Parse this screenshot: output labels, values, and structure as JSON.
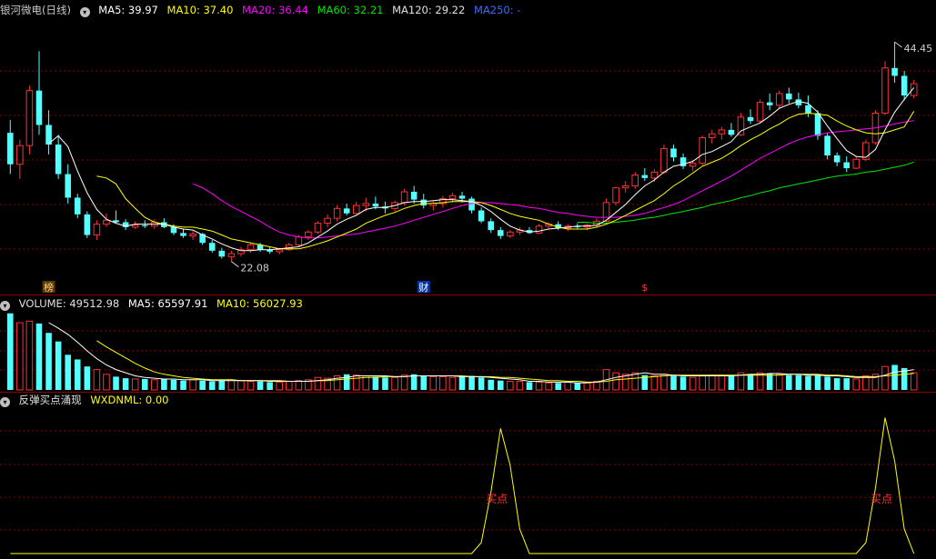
{
  "colors": {
    "background": "#000000",
    "up": "#ff3232",
    "down": "#54ffff",
    "ma5": "#ffffff",
    "ma10": "#ffff00",
    "ma20": "#ff00ff",
    "ma60": "#00e600",
    "ma120": "#e0e0e0",
    "ma250": "#3030ff",
    "grid": "#8b0000",
    "signal": "#ffff00",
    "signal_text": "#ff3232"
  },
  "price_panel": {
    "title": "银河微电(日线)",
    "ma_labels": [
      {
        "key": "ma5",
        "text": "MA5: 39.97"
      },
      {
        "key": "ma10",
        "text": "MA10: 37.40"
      },
      {
        "key": "ma20",
        "text": "MA20: 36.44"
      },
      {
        "key": "ma60",
        "text": "MA60: 32.21"
      },
      {
        "key": "ma120",
        "text": "MA120: 29.22"
      },
      {
        "key": "ma250",
        "text": "MA250: -"
      }
    ],
    "high_label": "44.45",
    "low_label": "22.08",
    "markers": [
      {
        "text": "榜",
        "index": 4,
        "color": "#ffd27f",
        "bg": "#5a3a00"
      },
      {
        "text": "财",
        "index": 43,
        "color": "#ffffff",
        "bg": "#0033aa"
      },
      {
        "text": "$",
        "index": 66,
        "color": "#ff3232",
        "bg": ""
      }
    ]
  },
  "volume_panel": {
    "labels": [
      {
        "key": "ma120",
        "text": "VOLUME: 49512.98"
      },
      {
        "key": "ma5",
        "text": "MA5: 65597.91"
      },
      {
        "key": "ma10",
        "text": "MA10: 56027.93"
      }
    ]
  },
  "indicator_panel": {
    "labels": [
      {
        "key": "ma120",
        "text": "反弹买点涌现"
      },
      {
        "key": "ma10",
        "text": "WXDNML: 0.00"
      }
    ],
    "signal_label": "买点"
  },
  "chart_data": {
    "type": "candlestick",
    "title": "银河微电(日线)",
    "ylim": [
      20.5,
      46.5
    ],
    "candles": [
      [
        35.2,
        36.5,
        31.0,
        32.0
      ],
      [
        32.0,
        34.5,
        30.5,
        33.9
      ],
      [
        33.9,
        40.0,
        33.0,
        39.5
      ],
      [
        39.5,
        43.5,
        35.0,
        36.0
      ],
      [
        36.0,
        37.5,
        33.0,
        34.0
      ],
      [
        34.0,
        35.0,
        30.5,
        31.0
      ],
      [
        31.0,
        32.0,
        28.0,
        28.6
      ],
      [
        28.6,
        29.0,
        26.5,
        26.9
      ],
      [
        26.9,
        27.2,
        24.5,
        24.8
      ],
      [
        24.8,
        26.3,
        24.3,
        25.9
      ],
      [
        25.9,
        27.0,
        25.6,
        26.3
      ],
      [
        26.3,
        27.3,
        26.0,
        26.1
      ],
      [
        26.1,
        26.4,
        25.3,
        25.6
      ],
      [
        25.6,
        26.2,
        25.4,
        25.8
      ],
      [
        25.8,
        26.3,
        25.5,
        25.7
      ],
      [
        25.7,
        26.4,
        25.4,
        26.1
      ],
      [
        26.1,
        26.5,
        25.5,
        25.6
      ],
      [
        25.6,
        25.9,
        24.8,
        25.0
      ],
      [
        25.0,
        25.4,
        24.5,
        24.7
      ],
      [
        24.7,
        25.2,
        24.3,
        24.9
      ],
      [
        24.9,
        25.0,
        23.8,
        24.0
      ],
      [
        24.0,
        24.3,
        23.0,
        23.2
      ],
      [
        23.2,
        23.5,
        22.4,
        22.6
      ],
      [
        22.6,
        23.2,
        22.1,
        22.9
      ],
      [
        22.9,
        23.6,
        22.6,
        23.3
      ],
      [
        23.3,
        24.0,
        23.0,
        23.8
      ],
      [
        23.8,
        24.0,
        23.1,
        23.3
      ],
      [
        23.3,
        23.6,
        22.9,
        23.1
      ],
      [
        23.1,
        23.5,
        22.8,
        23.3
      ],
      [
        23.3,
        24.0,
        23.2,
        23.8
      ],
      [
        23.8,
        24.8,
        23.6,
        24.6
      ],
      [
        24.6,
        25.3,
        24.3,
        25.1
      ],
      [
        25.1,
        26.2,
        24.9,
        26.0
      ],
      [
        26.0,
        26.9,
        25.6,
        26.5
      ],
      [
        26.5,
        27.8,
        26.2,
        27.5
      ],
      [
        27.5,
        28.0,
        26.8,
        27.0
      ],
      [
        27.0,
        28.2,
        26.9,
        27.8
      ],
      [
        27.8,
        28.6,
        27.2,
        28.0
      ],
      [
        28.0,
        28.7,
        27.4,
        27.7
      ],
      [
        27.7,
        28.2,
        27.0,
        27.5
      ],
      [
        27.5,
        28.3,
        27.2,
        28.1
      ],
      [
        28.1,
        29.5,
        27.8,
        29.2
      ],
      [
        29.2,
        29.8,
        28.0,
        28.4
      ],
      [
        28.4,
        29.0,
        27.5,
        27.8
      ],
      [
        27.8,
        28.3,
        27.3,
        28.0
      ],
      [
        28.0,
        28.8,
        27.6,
        28.5
      ],
      [
        28.5,
        29.1,
        28.1,
        28.8
      ],
      [
        28.8,
        29.2,
        28.1,
        28.5
      ],
      [
        28.5,
        28.7,
        27.0,
        27.3
      ],
      [
        27.3,
        27.6,
        26.0,
        26.2
      ],
      [
        26.2,
        26.5,
        25.0,
        25.3
      ],
      [
        25.3,
        25.6,
        24.4,
        24.7
      ],
      [
        24.7,
        25.3,
        24.5,
        25.1
      ],
      [
        25.1,
        25.6,
        24.8,
        25.3
      ],
      [
        25.3,
        25.6,
        24.9,
        25.0
      ],
      [
        25.0,
        25.9,
        24.9,
        25.7
      ],
      [
        25.7,
        26.1,
        25.4,
        25.9
      ],
      [
        25.9,
        26.2,
        25.3,
        25.5
      ],
      [
        25.5,
        25.9,
        25.2,
        25.7
      ],
      [
        25.7,
        26.0,
        25.4,
        25.6
      ],
      [
        25.6,
        26.0,
        25.3,
        25.8
      ],
      [
        25.8,
        26.5,
        25.6,
        26.2
      ],
      [
        26.2,
        28.5,
        26.1,
        28.1
      ],
      [
        28.1,
        29.7,
        27.8,
        29.6
      ],
      [
        29.6,
        30.3,
        29.1,
        29.8
      ],
      [
        29.8,
        31.2,
        29.5,
        30.9
      ],
      [
        30.9,
        31.6,
        30.3,
        30.6
      ],
      [
        30.6,
        31.5,
        30.2,
        31.2
      ],
      [
        31.2,
        34.0,
        31.0,
        33.6
      ],
      [
        33.6,
        34.0,
        32.3,
        32.7
      ],
      [
        32.7,
        33.1,
        31.5,
        31.8
      ],
      [
        31.8,
        32.4,
        31.3,
        32.1
      ],
      [
        32.1,
        34.9,
        31.9,
        34.7
      ],
      [
        34.7,
        35.5,
        34.1,
        35.1
      ],
      [
        35.1,
        35.8,
        34.5,
        35.5
      ],
      [
        35.5,
        36.2,
        34.8,
        35.0
      ],
      [
        35.0,
        37.2,
        34.9,
        36.8
      ],
      [
        36.8,
        37.6,
        36.1,
        36.4
      ],
      [
        36.4,
        38.6,
        36.2,
        38.3
      ],
      [
        38.3,
        39.2,
        37.5,
        38.0
      ],
      [
        38.0,
        39.5,
        37.7,
        39.2
      ],
      [
        39.2,
        39.8,
        38.2,
        38.6
      ],
      [
        38.6,
        39.3,
        37.7,
        38.0
      ],
      [
        38.0,
        39.0,
        36.8,
        37.2
      ],
      [
        37.2,
        37.5,
        34.5,
        34.9
      ],
      [
        34.9,
        35.2,
        32.5,
        32.9
      ],
      [
        32.9,
        33.2,
        31.8,
        32.2
      ],
      [
        32.2,
        32.8,
        31.2,
        31.6
      ],
      [
        31.6,
        32.8,
        31.5,
        32.5
      ],
      [
        32.5,
        34.5,
        32.3,
        34.2
      ],
      [
        34.2,
        37.5,
        34.0,
        37.2
      ],
      [
        37.2,
        42.5,
        37.0,
        41.8
      ],
      [
        41.8,
        44.45,
        40.3,
        41.0
      ],
      [
        41.0,
        41.5,
        38.5,
        39.0
      ],
      [
        39.0,
        40.6,
        38.7,
        40.2
      ]
    ],
    "ma5": [
      null,
      null,
      null,
      null,
      34.1,
      34.9,
      33.8,
      31.3,
      29.1,
      27.4,
      26.4,
      26.0,
      25.7,
      25.9,
      25.9,
      25.9,
      25.9,
      25.6,
      25.4,
      25.3,
      24.8,
      24.4,
      23.9,
      23.5,
      23.2,
      23.2,
      23.3,
      23.3,
      23.4,
      23.5,
      23.6,
      24.0,
      24.6,
      25.2,
      25.9,
      26.4,
      26.8,
      27.4,
      27.6,
      27.6,
      27.8,
      28.1,
      28.2,
      28.2,
      28.3,
      28.4,
      28.4,
      28.3,
      28.2,
      27.8,
      27.2,
      26.4,
      25.7,
      25.3,
      25.1,
      25.2,
      25.4,
      25.5,
      25.6,
      25.7,
      25.7,
      25.8,
      26.3,
      27.1,
      27.9,
      28.9,
      29.8,
      30.4,
      31.2,
      31.8,
      32.0,
      32.3,
      33.0,
      33.3,
      33.8,
      34.3,
      35.4,
      35.8,
      36.2,
      36.9,
      37.7,
      38.1,
      38.4,
      38.2,
      37.3,
      35.9,
      34.6,
      33.4,
      32.8,
      32.7,
      33.5,
      35.5,
      37.3,
      38.6,
      39.8
    ],
    "ma10": [
      null,
      null,
      null,
      null,
      null,
      null,
      null,
      null,
      null,
      30.8,
      30.6,
      30.0,
      28.5,
      27.5,
      26.6,
      26.1,
      25.9,
      25.7,
      25.6,
      25.6,
      25.4,
      25.2,
      24.8,
      24.4,
      24.2,
      24.0,
      23.8,
      23.6,
      23.4,
      23.4,
      23.4,
      23.6,
      23.9,
      24.2,
      24.6,
      25.0,
      25.4,
      26.0,
      26.4,
      26.8,
      27.1,
      27.5,
      27.8,
      28.0,
      28.0,
      28.1,
      28.2,
      28.2,
      28.2,
      28.1,
      27.8,
      27.4,
      27.0,
      26.7,
      26.5,
      26.3,
      25.9,
      25.6,
      25.4,
      25.4,
      25.4,
      25.6,
      25.9,
      26.3,
      26.8,
      27.3,
      27.8,
      28.3,
      29.0,
      29.8,
      30.4,
      31.1,
      31.8,
      32.2,
      32.6,
      33.2,
      33.9,
      34.5,
      35.0,
      35.6,
      36.1,
      36.7,
      37.1,
      37.2,
      37.1,
      37.0,
      36.4,
      35.9,
      35.5,
      35.2,
      35.1,
      35.2,
      35.5,
      35.8,
      37.4
    ],
    "ma20": [
      null,
      null,
      null,
      null,
      null,
      null,
      null,
      null,
      null,
      null,
      null,
      null,
      null,
      null,
      null,
      null,
      null,
      null,
      null,
      30.0,
      29.6,
      29.0,
      28.3,
      27.7,
      27.2,
      26.7,
      26.2,
      25.6,
      25.1,
      24.8,
      24.6,
      24.5,
      24.5,
      24.6,
      24.7,
      24.8,
      24.9,
      25.1,
      25.3,
      25.5,
      25.7,
      26.0,
      26.3,
      26.6,
      26.9,
      27.2,
      27.5,
      27.8,
      28.0,
      28.1,
      28.1,
      28.0,
      27.9,
      27.8,
      27.6,
      27.5,
      27.3,
      27.1,
      27.0,
      26.8,
      26.7,
      26.6,
      26.6,
      26.6,
      26.7,
      26.8,
      27.0,
      27.3,
      27.6,
      27.9,
      28.3,
      28.8,
      29.3,
      29.8,
      30.3,
      30.8,
      31.4,
      32.0,
      32.6,
      33.1,
      33.6,
      34.1,
      34.5,
      34.8,
      35.0,
      35.2,
      35.3,
      35.4,
      35.5,
      35.6,
      35.7,
      35.9,
      36.1,
      36.3,
      36.44
    ],
    "ma60": [
      null,
      null,
      null,
      null,
      null,
      null,
      null,
      null,
      null,
      null,
      null,
      null,
      null,
      null,
      null,
      null,
      null,
      null,
      null,
      null,
      null,
      null,
      null,
      null,
      null,
      null,
      null,
      null,
      null,
      null,
      null,
      null,
      null,
      null,
      null,
      null,
      null,
      null,
      null,
      null,
      null,
      null,
      null,
      null,
      null,
      null,
      null,
      null,
      null,
      null,
      null,
      null,
      null,
      null,
      null,
      null,
      null,
      null,
      null,
      26.1,
      26.1,
      26.0,
      26.0,
      26.1,
      26.2,
      26.3,
      26.5,
      26.6,
      26.8,
      27.0,
      27.2,
      27.4,
      27.6,
      27.9,
      28.1,
      28.3,
      28.6,
      28.8,
      29.1,
      29.3,
      29.6,
      29.8,
      30.0,
      30.2,
      30.4,
      30.6,
      30.8,
      30.9,
      31.0,
      31.2,
      31.3,
      31.5,
      31.7,
      31.9,
      32.21
    ],
    "volume": [
      98000,
      86000,
      88000,
      85000,
      73000,
      62000,
      45000,
      39000,
      30000,
      26000,
      20000,
      17000,
      15000,
      14000,
      14000,
      13000,
      14000,
      13000,
      12000,
      13000,
      12000,
      11000,
      12000,
      13000,
      12000,
      11000,
      11000,
      10000,
      10000,
      11000,
      12000,
      13000,
      16000,
      15000,
      18000,
      20000,
      19000,
      18000,
      17000,
      16000,
      16000,
      19000,
      20000,
      18000,
      17000,
      17000,
      16000,
      17000,
      18000,
      16000,
      13000,
      12000,
      11000,
      11000,
      10000,
      10000,
      9000,
      9000,
      10000,
      9000,
      10000,
      11000,
      26000,
      22000,
      20000,
      22000,
      19000,
      18000,
      20000,
      18000,
      17000,
      16000,
      18000,
      19000,
      19000,
      18000,
      22000,
      20000,
      22000,
      21000,
      20000,
      19000,
      19000,
      18000,
      19000,
      17000,
      15000,
      15000,
      14000,
      18000,
      20000,
      30000,
      32000,
      28000,
      22000
    ],
    "vol_ma5": [
      null,
      null,
      null,
      null,
      86000,
      79000,
      71000,
      61000,
      50000,
      40000,
      32000,
      26000,
      22000,
      18000,
      16000,
      15000,
      14000,
      14000,
      13000,
      13000,
      13000,
      12000,
      12000,
      12000,
      12000,
      12000,
      12000,
      11000,
      11000,
      11000,
      11000,
      11000,
      12000,
      13000,
      15000,
      16000,
      18000,
      18000,
      18000,
      18000,
      17000,
      17000,
      18000,
      18000,
      18000,
      18000,
      18000,
      17000,
      17000,
      17000,
      16000,
      15000,
      14000,
      13000,
      11000,
      11000,
      10000,
      10000,
      10000,
      9000,
      9000,
      10000,
      13000,
      16000,
      18000,
      20000,
      22000,
      20000,
      20000,
      19000,
      18000,
      18000,
      18000,
      18000,
      18000,
      18000,
      19000,
      20000,
      20000,
      21000,
      21000,
      20000,
      20000,
      19000,
      19000,
      18000,
      18000,
      17000,
      16000,
      16000,
      16000,
      19000,
      23000,
      24000,
      26000
    ],
    "vol_ma10": [
      null,
      null,
      null,
      null,
      null,
      null,
      null,
      null,
      null,
      63000,
      55000,
      48000,
      41000,
      34000,
      28000,
      23000,
      20000,
      18000,
      16000,
      15000,
      14000,
      13000,
      13000,
      13000,
      12000,
      12000,
      12000,
      12000,
      12000,
      11000,
      11000,
      11000,
      12000,
      12000,
      13000,
      14000,
      15000,
      16000,
      16000,
      17000,
      17000,
      17000,
      18000,
      18000,
      18000,
      18000,
      18000,
      18000,
      17000,
      17000,
      17000,
      16000,
      16000,
      15000,
      14000,
      13000,
      12000,
      12000,
      11000,
      11000,
      10000,
      10000,
      11000,
      13000,
      14000,
      15000,
      16000,
      17000,
      18000,
      19000,
      19000,
      19000,
      19000,
      19000,
      19000,
      19000,
      19000,
      19000,
      19000,
      19000,
      19000,
      20000,
      20000,
      20000,
      20000,
      19000,
      19000,
      18000,
      17000,
      17000,
      17000,
      18000,
      19000,
      20000,
      21000
    ],
    "signal": [
      0,
      0,
      0,
      0,
      0,
      0,
      0,
      0,
      0,
      0,
      0,
      0,
      0,
      0,
      0,
      0,
      0,
      0,
      0,
      0,
      0,
      0,
      0,
      0,
      0,
      0,
      0,
      0,
      0,
      0,
      0,
      0,
      0,
      0,
      0,
      0,
      0,
      0,
      0,
      0,
      0,
      0,
      0,
      0,
      0,
      0,
      0,
      0,
      0,
      0.08,
      0.45,
      0.92,
      0.65,
      0.18,
      0,
      0,
      0,
      0,
      0,
      0,
      0,
      0,
      0,
      0,
      0,
      0,
      0,
      0,
      0,
      0,
      0,
      0,
      0,
      0,
      0,
      0,
      0,
      0,
      0,
      0,
      0,
      0,
      0,
      0,
      0,
      0,
      0,
      0,
      0,
      0.08,
      0.48,
      1.0,
      0.68,
      0.18,
      0
    ],
    "signal_ylim": [
      0,
      1.05
    ]
  }
}
